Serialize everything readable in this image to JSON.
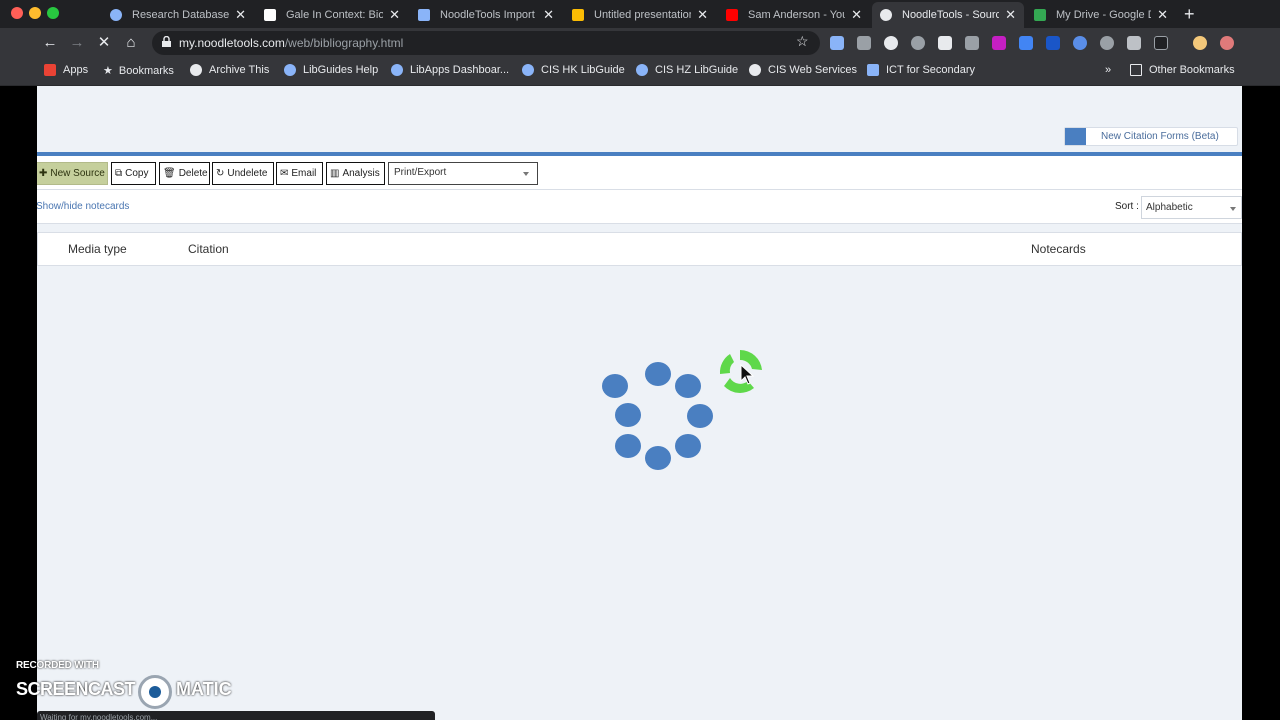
{
  "browser": {
    "tabs": [
      {
        "label": "Research Databases",
        "color": "#8ab4f8"
      },
      {
        "label": "Gale In Context: Biog",
        "color": "#ffffff"
      },
      {
        "label": "NoodleTools Import",
        "color": "#8ab4f8"
      },
      {
        "label": "Untitled presentation",
        "color": "#fbbc04"
      },
      {
        "label": "Sam Anderson - You",
        "color": "#ff0000"
      },
      {
        "label": "NoodleTools - Sourc",
        "color": "#e8eaed"
      },
      {
        "label": "My Drive - Google D",
        "color": "#34a853"
      }
    ],
    "url_host": "my.noodletools.com",
    "url_path": "/web/bibliography.html",
    "bookmarks": [
      {
        "label": "Apps",
        "icon": "apps-grid-icon"
      },
      {
        "label": "Bookmarks",
        "icon": "star-icon"
      },
      {
        "label": "Archive This",
        "icon": "globe-icon"
      },
      {
        "label": "LibGuides Help",
        "icon": "cloud-icon"
      },
      {
        "label": "LibApps Dashboar...",
        "icon": "cloud-icon"
      },
      {
        "label": "CIS HK LibGuide",
        "icon": "cloud-icon"
      },
      {
        "label": "CIS HZ LibGuide",
        "icon": "cloud-icon"
      },
      {
        "label": "CIS Web Services",
        "icon": "globe-icon"
      },
      {
        "label": "ICT for Secondary",
        "icon": "page-icon"
      }
    ],
    "bookmarks_overflow": "»",
    "other_bookmarks": "Other Bookmarks",
    "status_text": "Waiting for my.noodletools.com..."
  },
  "page": {
    "new_citation_forms": "New Citation Forms (Beta)",
    "actions": {
      "new_source": "New Source",
      "copy": "Copy",
      "delete": "Delete",
      "undelete": "Undelete",
      "email": "Email",
      "analysis": "Analysis",
      "print_export": "Print/Export"
    },
    "show_hide": "Show/hide notecards",
    "sort_label": "Sort :",
    "sort_value": "Alphabetic",
    "columns": {
      "media_type": "Media type",
      "citation": "Citation",
      "notecards": "Notecards"
    },
    "accent": "#4a7fc1"
  },
  "watermark": {
    "line1": "RECORDED WITH",
    "line2a": "SCREENCAST",
    "line2b": "MATIC"
  }
}
